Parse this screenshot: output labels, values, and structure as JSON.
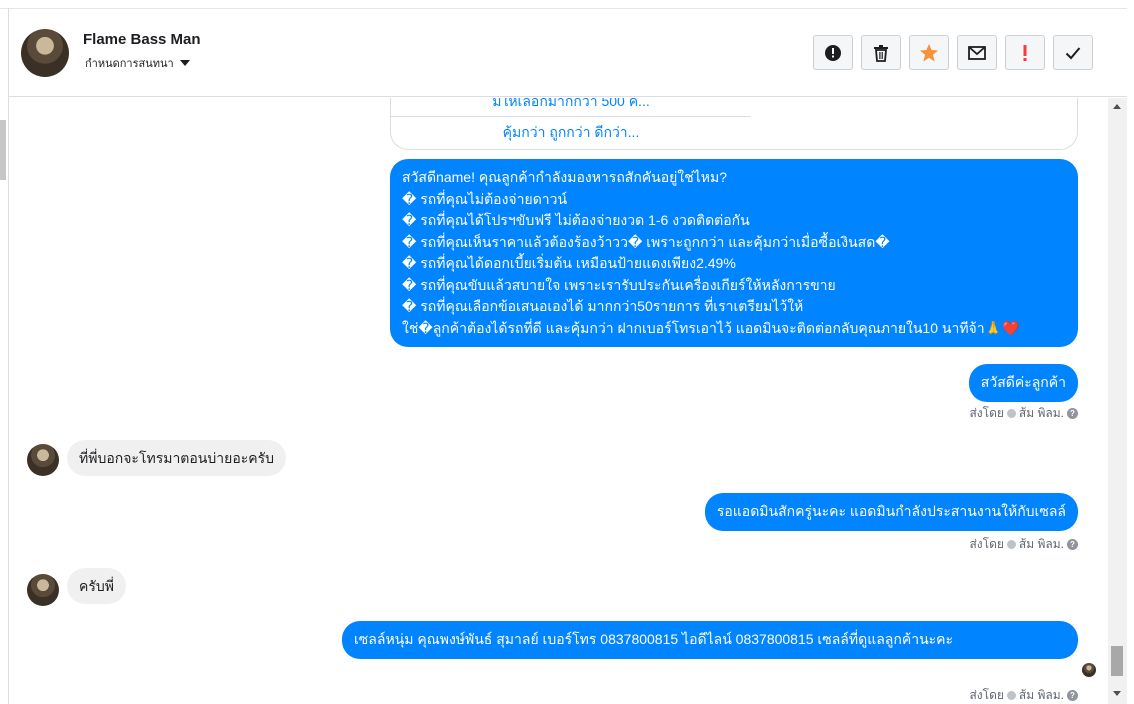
{
  "header": {
    "name": "Flame Bass Man",
    "subtitle": "กำหนดการสนทนา",
    "action_icons": [
      "alert-circle-icon",
      "trash-icon",
      "star-icon",
      "envelope-icon",
      "exclamation-icon",
      "check-icon"
    ]
  },
  "card": {
    "link1": "มีให้เลือกมากกว่า 500 คั...",
    "link2": "คุ้มกว่า ถูกกว่า ดีกว่า..."
  },
  "messages": {
    "m1": {
      "line1": "สวัสดีname! คุณลูกค้ากำลังมองหารถสักคันอยู่ใช่ไหม?",
      "line2": "� รถที่คุณไม่ต้องจ่ายดาวน์",
      "line3": "� รถที่คุณได้โปรฯขับฟรี ไม่ต้องจ่ายงวด 1-6 งวดติดต่อกัน",
      "line4": "� รถที่คุณเห็นราคาแล้วต้องร้องว้าวว� เพราะถูกกว่า และคุ้มกว่าเมื่อซื้อเงินสด�",
      "line5": "� รถที่คุณได้ดอกเบี้ยเริ่มต้น เหมือนป้ายแดงเพียง2.49%",
      "line6": "� รถที่คุณขับแล้วสบายใจ เพราะเรารับประกันเครื่องเกียร์ให้หลังการขาย",
      "line7": "� รถที่คุณเลือกข้อเสนอเองได้ มากกว่า50รายการ ที่เราเตรียมไว้ให้",
      "line8": "ใช่�ลูกค้าต้องได้รถที่ดี และคุ้มกว่า ฝากเบอร์โทรเอาไว้ แอดมินจะติดต่อกลับคุณภายใน10 นาทีจ้า",
      "emoji": "🙏❤️"
    },
    "m2": "สวัสดีค่ะลูกค้า",
    "m3": "ที่พี่บอกจะโทรมาตอนบ่ายอะครับ",
    "m4": "รอแอดมินสักครู่นะคะ แอดมินกำลังประสานงานให้กับเซลล์",
    "m5": "ครับพี่",
    "m6": "เซลล์หนุ่ม      คุณพงษ์พันธ์ สุมาลย์      เบอร์โทร 0837800815  ไอดีไลน์ 0837800815 เซลล์ที่ดูแลลูกค้านะคะ"
  },
  "sent_by": {
    "prefix": "ส่งโดย",
    "name": "ส้ม พิลม.",
    "help": "?"
  }
}
